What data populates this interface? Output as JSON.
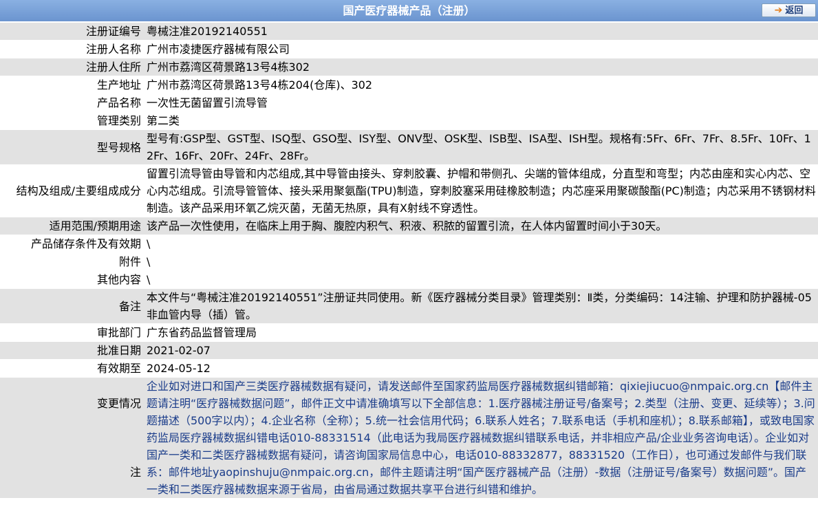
{
  "header": {
    "title": "国产医疗器械产品（注册）",
    "back_label": "返回"
  },
  "rows": {
    "reg_no": {
      "label": "注册证编号",
      "value": "粤械注准20192140551"
    },
    "registrant_name": {
      "label": "注册人名称",
      "value": "广州市凌捷医疗器械有限公司"
    },
    "registrant_address": {
      "label": "注册人住所",
      "value": "广州市荔湾区荷景路13号4栋302"
    },
    "production_address": {
      "label": "生产地址",
      "value": "广州市荔湾区荷景路13号4栋204(仓库)、302"
    },
    "product_name": {
      "label": "产品名称",
      "value": "一次性无菌留置引流导管"
    },
    "management_class": {
      "label": "管理类别",
      "value": "第二类"
    },
    "model_spec": {
      "label": "型号规格",
      "value": "型号有:GSP型、GST型、ISQ型、GSO型、ISY型、ONV型、OSK型、ISB型、ISA型、ISH型。规格有:5Fr、6Fr、7Fr、8.5Fr、10Fr、12Fr、16Fr、20Fr、24Fr、28Fr。"
    },
    "structure": {
      "label": "结构及组成/主要组成成分",
      "value": "留置引流导管由导管和内芯组成,其中导管由接头、穿刺胶囊、护帽和带侧孔、尖端的管体组成，分直型和弯型；内芯由座和实心内芯、空心内芯组成。引流导管管体、接头采用聚氨酯(TPU)制造，穿刺胶塞采用硅橡胶制造；内芯座采用聚碳酸酯(PC)制造；内芯采用不锈钢材料制造。该产品采用环氧乙烷灭菌，无菌无热原，具有X射线不穿透性。"
    },
    "intended_use": {
      "label": "适用范围/预期用途",
      "value": "该产品一次性使用，在临床上用于胸、腹腔内积气、积液、积脓的留置引流，在人体内留置时间小于30天。"
    },
    "storage": {
      "label": "产品储存条件及有效期",
      "value": "\\"
    },
    "attachment": {
      "label": "附件",
      "value": "\\"
    },
    "other": {
      "label": "其他内容",
      "value": "\\"
    },
    "remarks": {
      "label": "备注",
      "value": "本文件与“粤械注准20192140551”注册证共同使用。新《医疗器械分类目录》管理类别：Ⅱ类，分类编码：14注输、护理和防护器械-05非血管内导（插）管。"
    },
    "approval_dept": {
      "label": "审批部门",
      "value": "广东省药品监督管理局"
    },
    "approval_date": {
      "label": "批准日期",
      "value": "2021-02-07"
    },
    "valid_until": {
      "label": "有效期至",
      "value": "2024-05-12"
    },
    "changes": {
      "label": "变更情况",
      "value": ""
    },
    "notice": {
      "label": "注",
      "value": "企业如对进口和国产三类医疗器械数据有疑问，请发送邮件至国家药监局医疗器械数据纠错邮箱：qixiejiucuo@nmpaic.org.cn【邮件主题请注明“医疗器械数据问题”，邮件正文中请准确填写以下全部信息：1.医疗器械注册证号/备案号；2.类型（注册、变更、延续等）；3.问题描述（500字以内）；4.企业名称（全称）；5.统一社会信用代码；6.联系人姓名；7.联系电话（手机和座机）；8.联系邮箱】，或致电国家药监局医疗器械数据纠错电话010-88331514（此电话为我局医疗器械数据纠错联系电话，并非相应产品/企业业务咨询电话）。企业如对国产一类和二类医疗器械数据有疑问，请咨询国家局信息中心，电话010-88332877，88331520（工作日），也可通过发邮件与我们联系：邮件地址yaopinshuju@nmpaic.org.cn，邮件主题请注明“国产医疗器械产品（注册）-数据（注册证号/备案号）数据问题”。国产一类和二类医疗器械数据来源于省局，由省局通过数据共享平台进行纠错和维护。"
    }
  },
  "colors": {
    "header_bg": "#7aa2d9",
    "row_shade": "#e2e2e2",
    "notice_text": "#1a3c8a"
  }
}
